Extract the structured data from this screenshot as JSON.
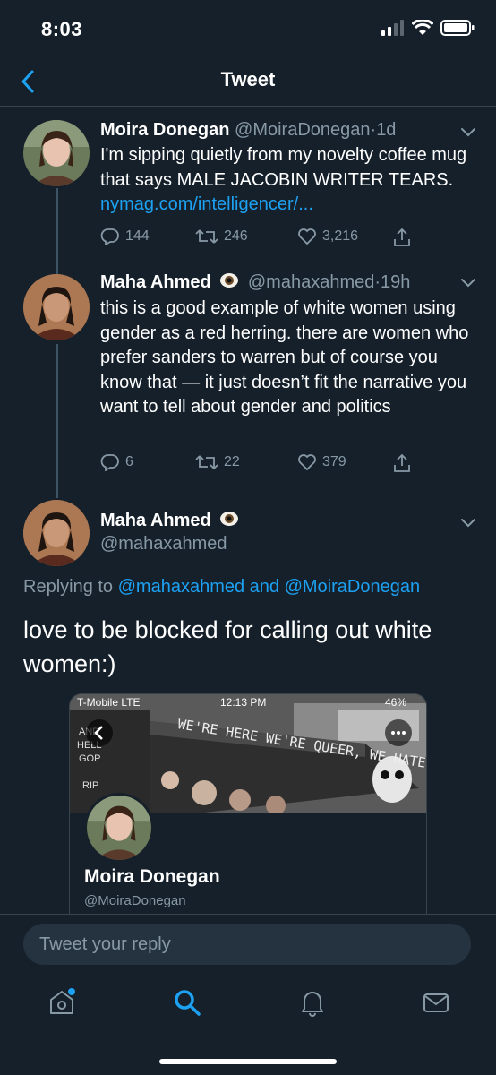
{
  "status_bar": {
    "time": "8:03"
  },
  "nav": {
    "title": "Tweet",
    "back_icon": "chevron-left-icon"
  },
  "tweets": [
    {
      "name": "Moira Donegan",
      "handle": "@MoiraDonegan",
      "sep": "·",
      "age": "1d",
      "text": "I'm sipping quietly from my novelty coffee mug that says MALE JACOBIN WRITER TEARS. ",
      "link": "nymag.com/intelligencer/...",
      "replies": "144",
      "retweets": "246",
      "likes": "3,216"
    },
    {
      "name": "Maha Ahmed",
      "handle": "@mahaxahmed",
      "sep": "·",
      "age": "19h",
      "text": "this is a good example of white women using gender as a red herring. there are women who prefer sanders to warren but of course you know that — it just doesn’t fit the narrative you want to tell about gender and politics",
      "replies": "6",
      "retweets": "22",
      "likes": "379"
    }
  ],
  "main_tweet": {
    "name": "Maha Ahmed",
    "handle": "@mahaxahmed",
    "replying_prefix": "Replying to ",
    "replying_user1": "@mahaxahmed",
    "replying_and": " and ",
    "replying_user2": "@MoiraDonegan",
    "text": "love to be blocked for calling out white women:)"
  },
  "embedded_card": {
    "status_carrier": "T-Mobile  LTE",
    "status_time": "12:13 PM",
    "status_battery": "46%",
    "sign_text": "WE'RE HERE WE'RE QUEER, WE HATE THE FUCKING PRESIDENT!",
    "name": "Moira Donegan",
    "handle": "@MoiraDonegan"
  },
  "reply_bar": {
    "placeholder": "Tweet your reply"
  },
  "tab_bar": {
    "icons": [
      "home-icon",
      "search-icon",
      "notifications-icon",
      "messages-icon"
    ],
    "active": "search-icon"
  },
  "colors": {
    "background": "#15202b",
    "accent": "#1da1f2",
    "secondary_text": "#8899a6",
    "divider": "#38444d"
  }
}
